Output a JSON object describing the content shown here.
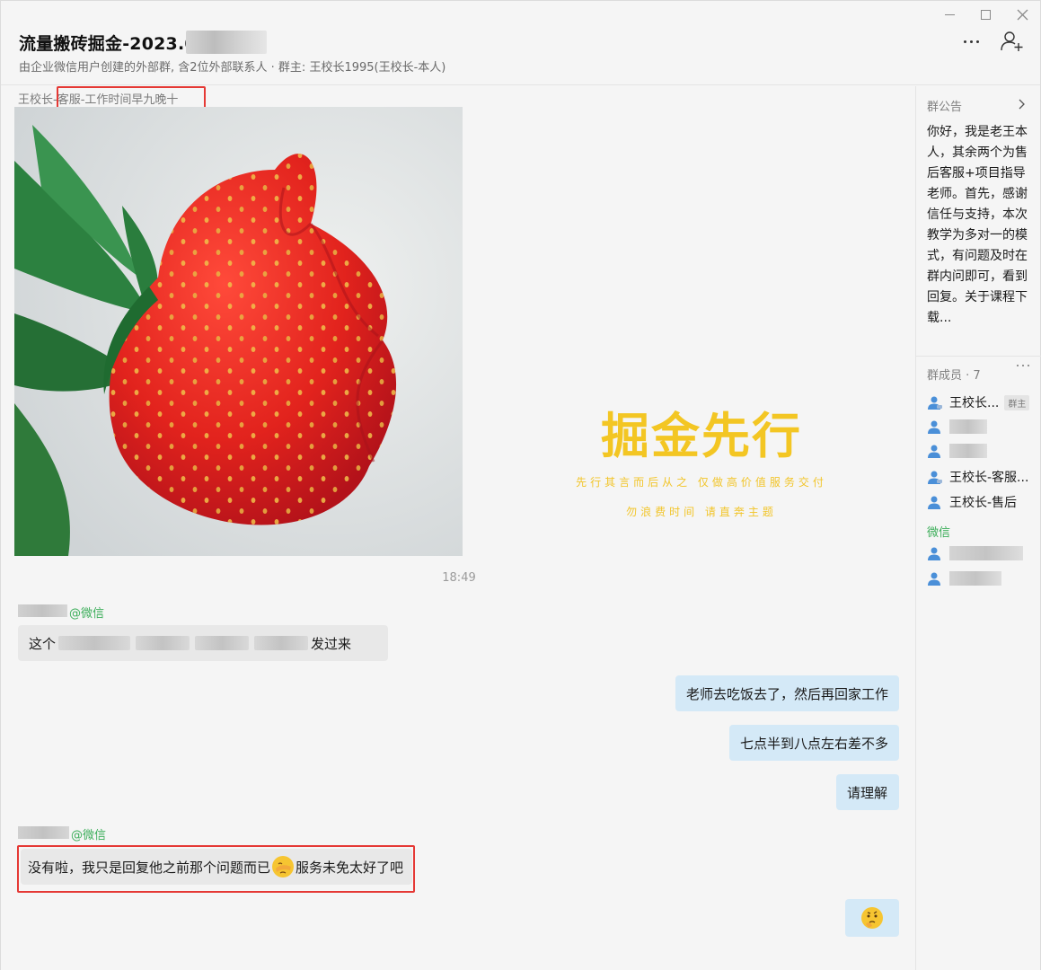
{
  "window": {
    "title": "流量搬砖掘金-2023.0",
    "subtitle": "由企业微信用户创建的外部群, 含2位外部联系人 · 群主: 王校长1995(王校长-本人)"
  },
  "chat": {
    "messages": [
      {
        "sender_prefix": "王校长-",
        "sender_highlight": "客服-工作时间早九晚十",
        "type": "image",
        "watermark": {
          "title": "掘金先行",
          "line1": "先行其言而后从之 仅做高价值服务交付",
          "line2": "勿浪费时间 请直奔主题"
        }
      }
    ],
    "timestamp": "18:49",
    "msg2": {
      "sender_suffix": "@微信",
      "text_start": "这个",
      "text_end": "发过来"
    },
    "msg3": {
      "text": "老师去吃饭去了，然后再回家工作"
    },
    "msg4": {
      "text": "七点半到八点左右差不多"
    },
    "msg5": {
      "text": "请理解"
    },
    "msg6": {
      "sender_suffix": "@微信",
      "text_start": "没有啦，我只是回复他之前那个问题而已",
      "text_end": "服务未免太好了吧"
    }
  },
  "side": {
    "notice_title": "群公告",
    "notice_text": "你好，我是老王本人，其余两个为售后客服+项目指导老师。首先，感谢信任与支持，本次教学为多对一的模式，有问题及时在群内问即可，看到回复。关于课程下载...",
    "members_title": "群成员 · 7",
    "members": [
      {
        "name": "王校长...",
        "badge": "群主"
      },
      {
        "name": "王校长-客服..."
      },
      {
        "name": "王校长-售后"
      }
    ],
    "wechat_group_label": "微信"
  },
  "colors": {
    "accent_green": "#3cae5a",
    "outgoing_bubble": "#d4e9f7",
    "incoming_bubble": "#e8e8e8",
    "annotation_red": "#e53935",
    "watermark_gold": "#f3c623"
  }
}
